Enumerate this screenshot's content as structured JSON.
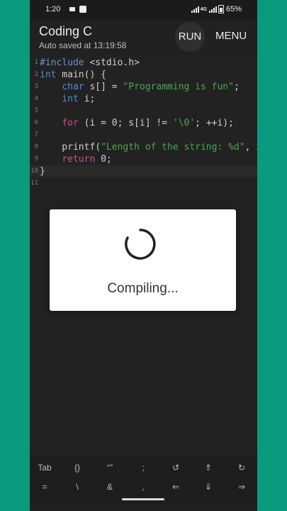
{
  "status_bar": {
    "time": "1:20",
    "network": "4G",
    "battery": "65%"
  },
  "app_bar": {
    "title": "Coding C",
    "subtitle": "Auto saved at 13:19:58",
    "run_label": "RUN",
    "menu_label": "MENU"
  },
  "editor": {
    "line_numbers": [
      "1",
      "2",
      "3",
      "4",
      "5",
      "6",
      "7",
      "8",
      "9",
      "10",
      "11"
    ]
  },
  "dialog": {
    "text": "Compiling..."
  },
  "keys": {
    "row1": [
      "Tab",
      "{}",
      "“”",
      ";",
      "↺",
      "⇑",
      "↻"
    ],
    "row2": [
      "=",
      "\\",
      "&",
      ",",
      "⇐",
      "⇓",
      "⇒"
    ]
  },
  "colors": {
    "background": "#0a9a7d",
    "editor_bg": "#222222",
    "keyword": "#4b8fd8",
    "string": "#4aa84a",
    "control": "#d9488f"
  }
}
